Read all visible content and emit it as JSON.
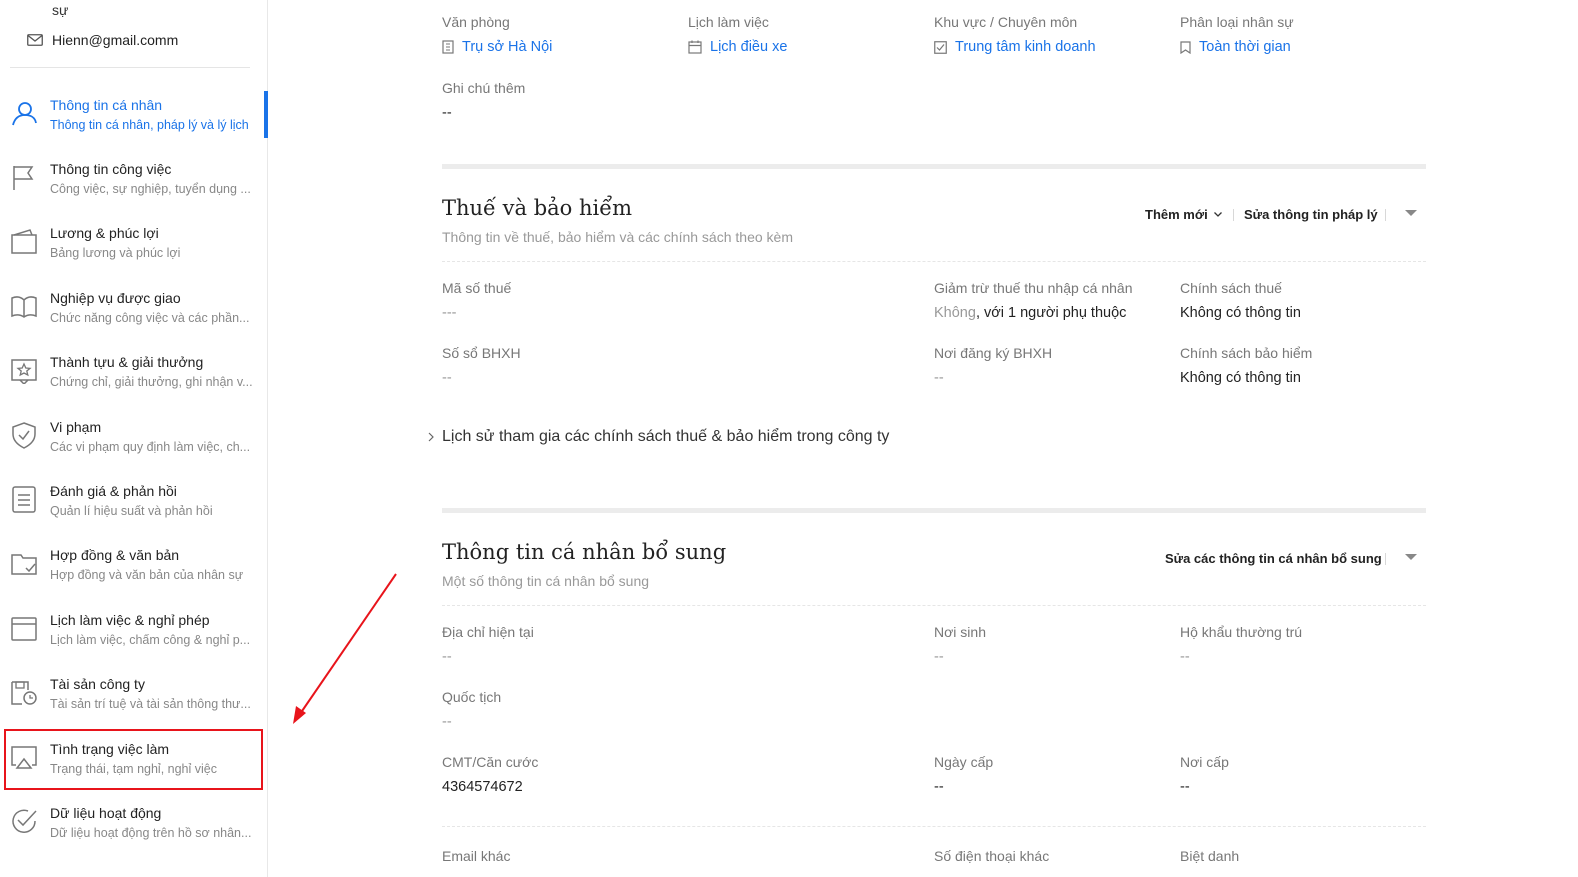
{
  "sidebar": {
    "profile_fragment": "sự",
    "email": "Hienn@gmail.comm",
    "items": [
      {
        "title": "Thông tin cá nhân",
        "sub": "Thông tin cá nhân, pháp lý và lý lịch",
        "icon": "user-icon"
      },
      {
        "title": "Thông tin công việc",
        "sub": "Công việc, sự nghiệp, tuyển dụng ...",
        "icon": "flag-icon"
      },
      {
        "title": "Lương & phúc lợi",
        "sub": "Bảng lương và phúc lợi",
        "icon": "wallet-icon"
      },
      {
        "title": "Nghiệp vụ được giao",
        "sub": "Chức năng công việc và các phần...",
        "icon": "book-icon"
      },
      {
        "title": "Thành tựu & giải thưởng",
        "sub": "Chứng chỉ, giải thưởng, ghi nhận v...",
        "icon": "star-icon"
      },
      {
        "title": "Vi phạm",
        "sub": "Các vi phạm quy định làm việc, ch...",
        "icon": "shield-icon"
      },
      {
        "title": "Đánh giá & phản hồi",
        "sub": "Quản lí hiệu suất và phản hồi",
        "icon": "list-icon"
      },
      {
        "title": "Hợp đồng & văn bản",
        "sub": "Hợp đồng và văn bản của nhân sự",
        "icon": "folder-icon"
      },
      {
        "title": "Lịch làm việc & nghỉ phép",
        "sub": "Lịch làm việc, chấm công & nghỉ p...",
        "icon": "calendar-icon"
      },
      {
        "title": "Tài sản công ty",
        "sub": "Tài sản trí tuệ và tài sản thông thư...",
        "icon": "asset-icon"
      },
      {
        "title": "Tình trạng việc làm",
        "sub": "Trạng thái, tạm nghỉ, nghỉ việc",
        "icon": "airplay-icon"
      },
      {
        "title": "Dữ liệu hoạt động",
        "sub": "Dữ liệu hoạt động trên hồ sơ nhân...",
        "icon": "check-circle-icon"
      }
    ]
  },
  "work": {
    "office_label": "Văn phòng",
    "office_value": "Trụ sở Hà Nội",
    "schedule_label": "Lịch làm việc",
    "schedule_value": "Lịch điều xe",
    "area_label": "Khu vực / Chuyên môn",
    "area_value": "Trung tâm kinh doanh",
    "type_label": "Phân loại nhân sự",
    "type_value": "Toàn thời gian",
    "note_label": "Ghi chú thêm",
    "note_value": "--"
  },
  "tax": {
    "title": "Thuế và bảo hiểm",
    "subtitle": "Thông tin về thuế, bảo hiểm và các chính sách theo kèm",
    "add_new": "Thêm mới",
    "edit_legal": "Sửa thông tin pháp lý",
    "tax_code_label": "Mã số thuế",
    "tax_code_value": "---",
    "deduction_label": "Giảm trừ thuế thu nhập cá nhân",
    "deduction_value_a": "Không",
    "deduction_value_b": ", với 1 người phụ thuộc",
    "tax_policy_label": "Chính sách thuế",
    "tax_policy_value": "Không có thông tin",
    "bhxh_label": "Số sổ BHXH",
    "bhxh_value": "--",
    "bhxh_reg_label": "Nơi đăng ký BHXH",
    "bhxh_reg_value": "--",
    "ins_policy_label": "Chính sách bảo hiểm",
    "ins_policy_value": "Không có thông tin",
    "history": "Lịch sử tham gia các chính sách thuế & bảo hiểm trong công ty"
  },
  "extra": {
    "title": "Thông tin cá nhân bổ sung",
    "subtitle": "Một số thông tin cá nhân bổ sung",
    "edit": "Sửa các thông tin cá nhân bổ sung",
    "address_label": "Địa chỉ hiện tại",
    "address_value": "--",
    "birthplace_label": "Nơi sinh",
    "birthplace_value": "--",
    "household_label": "Hộ khẩu thường trú",
    "household_value": "--",
    "nationality_label": "Quốc tịch",
    "nationality_value": "--",
    "id_label": "CMT/Căn cước",
    "id_value": "4364574672",
    "issue_date_label": "Ngày cấp",
    "issue_date_value": "--",
    "issue_place_label": "Nơi cấp",
    "issue_place_value": "--",
    "email_label": "Email khác",
    "phone_label": "Số điện thoại khác",
    "nickname_label": "Biệt danh"
  },
  "colors": {
    "accent": "#1a73e8",
    "highlight": "#e8141b"
  }
}
